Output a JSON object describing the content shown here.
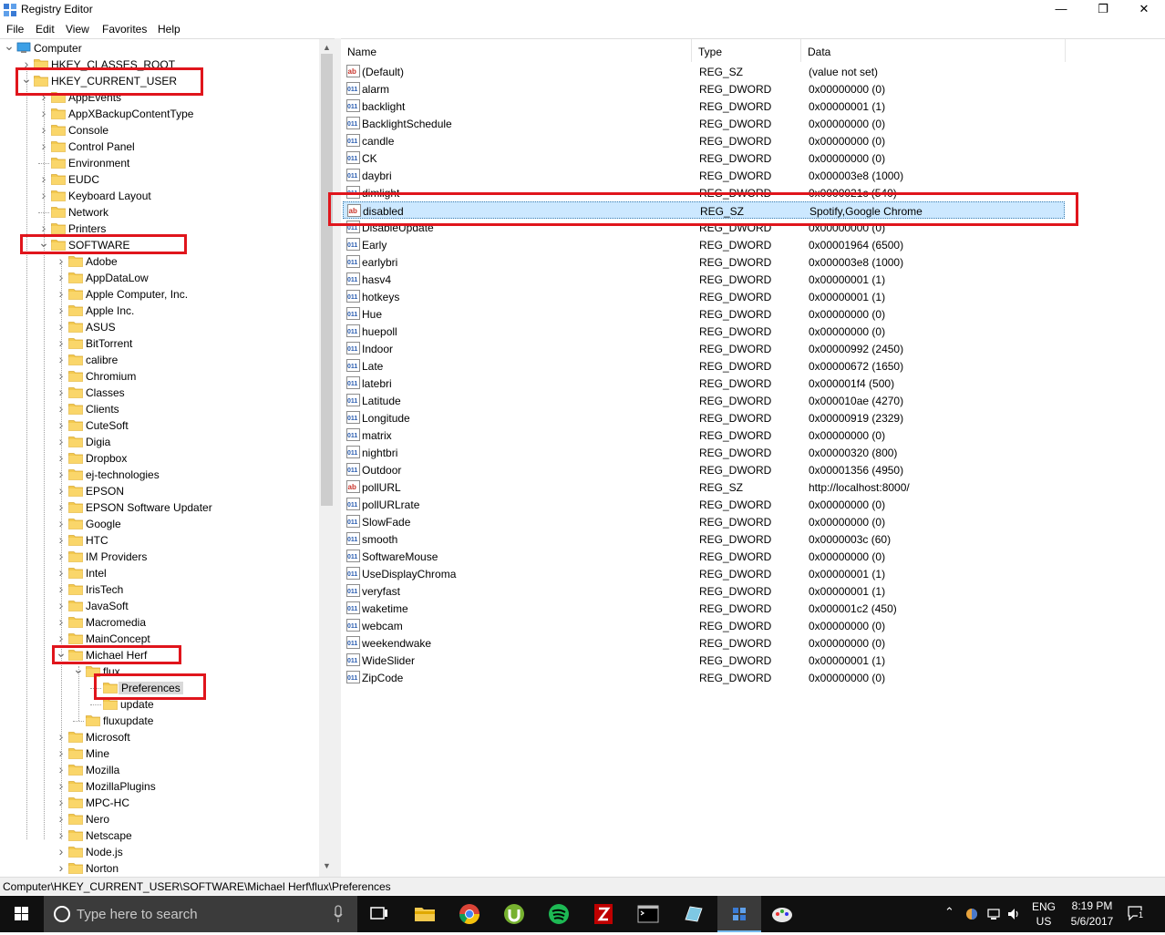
{
  "window": {
    "title": "Registry Editor",
    "minimize": "—",
    "maximize": "❐",
    "close": "✕"
  },
  "menu": [
    "File",
    "Edit",
    "View",
    "Favorites",
    "Help"
  ],
  "tree": [
    {
      "label": "Computer",
      "depth": 0,
      "expand": "expanded",
      "icon": "computer-icon"
    },
    {
      "label": "HKEY_CLASSES_ROOT",
      "depth": 1,
      "expand": "collapsed"
    },
    {
      "label": "HKEY_CURRENT_USER",
      "depth": 1,
      "expand": "expanded",
      "highlight": true
    },
    {
      "label": "AppEvents",
      "depth": 2,
      "expand": "collapsed"
    },
    {
      "label": "AppXBackupContentType",
      "depth": 2,
      "expand": "collapsed"
    },
    {
      "label": "Console",
      "depth": 2,
      "expand": "collapsed"
    },
    {
      "label": "Control Panel",
      "depth": 2,
      "expand": "collapsed"
    },
    {
      "label": "Environment",
      "depth": 2,
      "expand": "none"
    },
    {
      "label": "EUDC",
      "depth": 2,
      "expand": "collapsed"
    },
    {
      "label": "Keyboard Layout",
      "depth": 2,
      "expand": "collapsed"
    },
    {
      "label": "Network",
      "depth": 2,
      "expand": "none"
    },
    {
      "label": "Printers",
      "depth": 2,
      "expand": "collapsed"
    },
    {
      "label": "SOFTWARE",
      "depth": 2,
      "expand": "expanded",
      "highlight": true
    },
    {
      "label": "Adobe",
      "depth": 3,
      "expand": "collapsed"
    },
    {
      "label": "AppDataLow",
      "depth": 3,
      "expand": "collapsed"
    },
    {
      "label": "Apple Computer, Inc.",
      "depth": 3,
      "expand": "collapsed"
    },
    {
      "label": "Apple Inc.",
      "depth": 3,
      "expand": "collapsed"
    },
    {
      "label": "ASUS",
      "depth": 3,
      "expand": "collapsed"
    },
    {
      "label": "BitTorrent",
      "depth": 3,
      "expand": "collapsed"
    },
    {
      "label": "calibre",
      "depth": 3,
      "expand": "collapsed"
    },
    {
      "label": "Chromium",
      "depth": 3,
      "expand": "collapsed"
    },
    {
      "label": "Classes",
      "depth": 3,
      "expand": "collapsed"
    },
    {
      "label": "Clients",
      "depth": 3,
      "expand": "collapsed"
    },
    {
      "label": "CuteSoft",
      "depth": 3,
      "expand": "collapsed"
    },
    {
      "label": "Digia",
      "depth": 3,
      "expand": "collapsed"
    },
    {
      "label": "Dropbox",
      "depth": 3,
      "expand": "collapsed"
    },
    {
      "label": "ej-technologies",
      "depth": 3,
      "expand": "collapsed"
    },
    {
      "label": "EPSON",
      "depth": 3,
      "expand": "collapsed"
    },
    {
      "label": "EPSON Software Updater",
      "depth": 3,
      "expand": "collapsed"
    },
    {
      "label": "Google",
      "depth": 3,
      "expand": "collapsed"
    },
    {
      "label": "HTC",
      "depth": 3,
      "expand": "collapsed"
    },
    {
      "label": "IM Providers",
      "depth": 3,
      "expand": "collapsed"
    },
    {
      "label": "Intel",
      "depth": 3,
      "expand": "collapsed"
    },
    {
      "label": "IrisTech",
      "depth": 3,
      "expand": "collapsed"
    },
    {
      "label": "JavaSoft",
      "depth": 3,
      "expand": "collapsed"
    },
    {
      "label": "Macromedia",
      "depth": 3,
      "expand": "collapsed"
    },
    {
      "label": "MainConcept",
      "depth": 3,
      "expand": "collapsed"
    },
    {
      "label": "Michael Herf",
      "depth": 3,
      "expand": "expanded",
      "highlight": true
    },
    {
      "label": "flux",
      "depth": 4,
      "expand": "expanded"
    },
    {
      "label": "Preferences",
      "depth": 5,
      "expand": "none",
      "selected": true,
      "highlight": true
    },
    {
      "label": "update",
      "depth": 5,
      "expand": "none"
    },
    {
      "label": "fluxupdate",
      "depth": 4,
      "expand": "none"
    },
    {
      "label": "Microsoft",
      "depth": 3,
      "expand": "collapsed"
    },
    {
      "label": "Mine",
      "depth": 3,
      "expand": "collapsed"
    },
    {
      "label": "Mozilla",
      "depth": 3,
      "expand": "collapsed"
    },
    {
      "label": "MozillaPlugins",
      "depth": 3,
      "expand": "collapsed"
    },
    {
      "label": "MPC-HC",
      "depth": 3,
      "expand": "collapsed"
    },
    {
      "label": "Nero",
      "depth": 3,
      "expand": "collapsed"
    },
    {
      "label": "Netscape",
      "depth": 3,
      "expand": "collapsed"
    },
    {
      "label": "Node.js",
      "depth": 3,
      "expand": "collapsed"
    },
    {
      "label": "Norton",
      "depth": 3,
      "expand": "collapsed"
    }
  ],
  "columns": {
    "name": "Name",
    "type": "Type",
    "data": "Data"
  },
  "values": [
    {
      "name": "(Default)",
      "type": "REG_SZ",
      "data": "(value not set)",
      "kind": "sz"
    },
    {
      "name": "alarm",
      "type": "REG_DWORD",
      "data": "0x00000000 (0)",
      "kind": "dword"
    },
    {
      "name": "backlight",
      "type": "REG_DWORD",
      "data": "0x00000001 (1)",
      "kind": "dword"
    },
    {
      "name": "BacklightSchedule",
      "type": "REG_DWORD",
      "data": "0x00000000 (0)",
      "kind": "dword"
    },
    {
      "name": "candle",
      "type": "REG_DWORD",
      "data": "0x00000000 (0)",
      "kind": "dword"
    },
    {
      "name": "CK",
      "type": "REG_DWORD",
      "data": "0x00000000 (0)",
      "kind": "dword"
    },
    {
      "name": "daybri",
      "type": "REG_DWORD",
      "data": "0x000003e8 (1000)",
      "kind": "dword"
    },
    {
      "name": "dimlight",
      "type": "REG_DWORD",
      "data": "0x0000021c (540)",
      "kind": "dword"
    },
    {
      "name": "disabled",
      "type": "REG_SZ",
      "data": "Spotify,Google Chrome",
      "kind": "sz",
      "selected": true
    },
    {
      "name": "DisableUpdate",
      "type": "REG_DWORD",
      "data": "0x00000000 (0)",
      "kind": "dword"
    },
    {
      "name": "Early",
      "type": "REG_DWORD",
      "data": "0x00001964 (6500)",
      "kind": "dword"
    },
    {
      "name": "earlybri",
      "type": "REG_DWORD",
      "data": "0x000003e8 (1000)",
      "kind": "dword"
    },
    {
      "name": "hasv4",
      "type": "REG_DWORD",
      "data": "0x00000001 (1)",
      "kind": "dword"
    },
    {
      "name": "hotkeys",
      "type": "REG_DWORD",
      "data": "0x00000001 (1)",
      "kind": "dword"
    },
    {
      "name": "Hue",
      "type": "REG_DWORD",
      "data": "0x00000000 (0)",
      "kind": "dword"
    },
    {
      "name": "huepoll",
      "type": "REG_DWORD",
      "data": "0x00000000 (0)",
      "kind": "dword"
    },
    {
      "name": "Indoor",
      "type": "REG_DWORD",
      "data": "0x00000992 (2450)",
      "kind": "dword"
    },
    {
      "name": "Late",
      "type": "REG_DWORD",
      "data": "0x00000672 (1650)",
      "kind": "dword"
    },
    {
      "name": "latebri",
      "type": "REG_DWORD",
      "data": "0x000001f4 (500)",
      "kind": "dword"
    },
    {
      "name": "Latitude",
      "type": "REG_DWORD",
      "data": "0x000010ae (4270)",
      "kind": "dword"
    },
    {
      "name": "Longitude",
      "type": "REG_DWORD",
      "data": "0x00000919 (2329)",
      "kind": "dword"
    },
    {
      "name": "matrix",
      "type": "REG_DWORD",
      "data": "0x00000000 (0)",
      "kind": "dword"
    },
    {
      "name": "nightbri",
      "type": "REG_DWORD",
      "data": "0x00000320 (800)",
      "kind": "dword"
    },
    {
      "name": "Outdoor",
      "type": "REG_DWORD",
      "data": "0x00001356 (4950)",
      "kind": "dword"
    },
    {
      "name": "pollURL",
      "type": "REG_SZ",
      "data": "http://localhost:8000/",
      "kind": "sz"
    },
    {
      "name": "pollURLrate",
      "type": "REG_DWORD",
      "data": "0x00000000 (0)",
      "kind": "dword"
    },
    {
      "name": "SlowFade",
      "type": "REG_DWORD",
      "data": "0x00000000 (0)",
      "kind": "dword"
    },
    {
      "name": "smooth",
      "type": "REG_DWORD",
      "data": "0x0000003c (60)",
      "kind": "dword"
    },
    {
      "name": "SoftwareMouse",
      "type": "REG_DWORD",
      "data": "0x00000000 (0)",
      "kind": "dword"
    },
    {
      "name": "UseDisplayChroma",
      "type": "REG_DWORD",
      "data": "0x00000001 (1)",
      "kind": "dword"
    },
    {
      "name": "veryfast",
      "type": "REG_DWORD",
      "data": "0x00000001 (1)",
      "kind": "dword"
    },
    {
      "name": "waketime",
      "type": "REG_DWORD",
      "data": "0x000001c2 (450)",
      "kind": "dword"
    },
    {
      "name": "webcam",
      "type": "REG_DWORD",
      "data": "0x00000000 (0)",
      "kind": "dword"
    },
    {
      "name": "weekendwake",
      "type": "REG_DWORD",
      "data": "0x00000000 (0)",
      "kind": "dword"
    },
    {
      "name": "WideSlider",
      "type": "REG_DWORD",
      "data": "0x00000001 (1)",
      "kind": "dword"
    },
    {
      "name": "ZipCode",
      "type": "REG_DWORD",
      "data": "0x00000000 (0)",
      "kind": "dword"
    }
  ],
  "status_path": "Computer\\HKEY_CURRENT_USER\\SOFTWARE\\Michael Herf\\flux\\Preferences",
  "taskbar": {
    "search_placeholder": "Type here to search",
    "apps": [
      "task-view-icon",
      "file-explorer-icon",
      "chrome-icon",
      "utorrent-icon",
      "spotify-icon",
      "filezilla-icon",
      "command-prompt-icon",
      "notepad-icon",
      "registry-editor-icon",
      "paint-icon"
    ],
    "lang_top": "ENG",
    "lang_bottom": "US",
    "time": "8:19 PM",
    "date": "5/6/2017",
    "notifications": "1"
  },
  "colors": {
    "highlight_box": "#e0151c",
    "selection": "#cce8ff",
    "folder": "#f3c94e",
    "taskbar": "#101010"
  }
}
